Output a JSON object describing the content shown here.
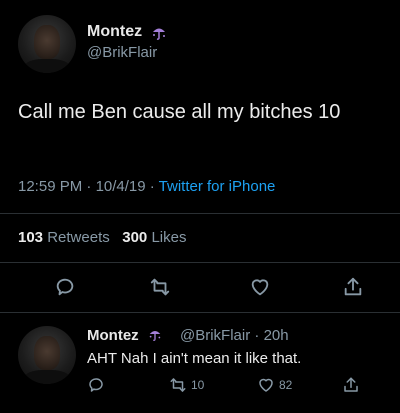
{
  "tweet": {
    "display_name": "Montez",
    "username": "@BrikFlair",
    "text": "Call me Ben cause all my bitches 10",
    "time": "12:59 PM",
    "date": "10/4/19",
    "source": "Twitter for iPhone",
    "retweet_count": "103",
    "retweet_label": "Retweets",
    "like_count": "300",
    "like_label": "Likes",
    "separator": " · "
  },
  "reply": {
    "display_name": "Montez",
    "username": "@BrikFlair",
    "age": "20h",
    "text": "AHT Nah I ain't mean it like that.",
    "retweet_count": "10",
    "like_count": "82"
  },
  "icons": {
    "emoji": "umbrella-rain-emoji",
    "reply": "reply-icon",
    "retweet": "retweet-icon",
    "like": "heart-icon",
    "share": "share-icon"
  },
  "colors": {
    "background": "#000000",
    "accent": "#1da1f2",
    "secondary_text": "#8899a6",
    "emoji": "#a47fd9"
  }
}
